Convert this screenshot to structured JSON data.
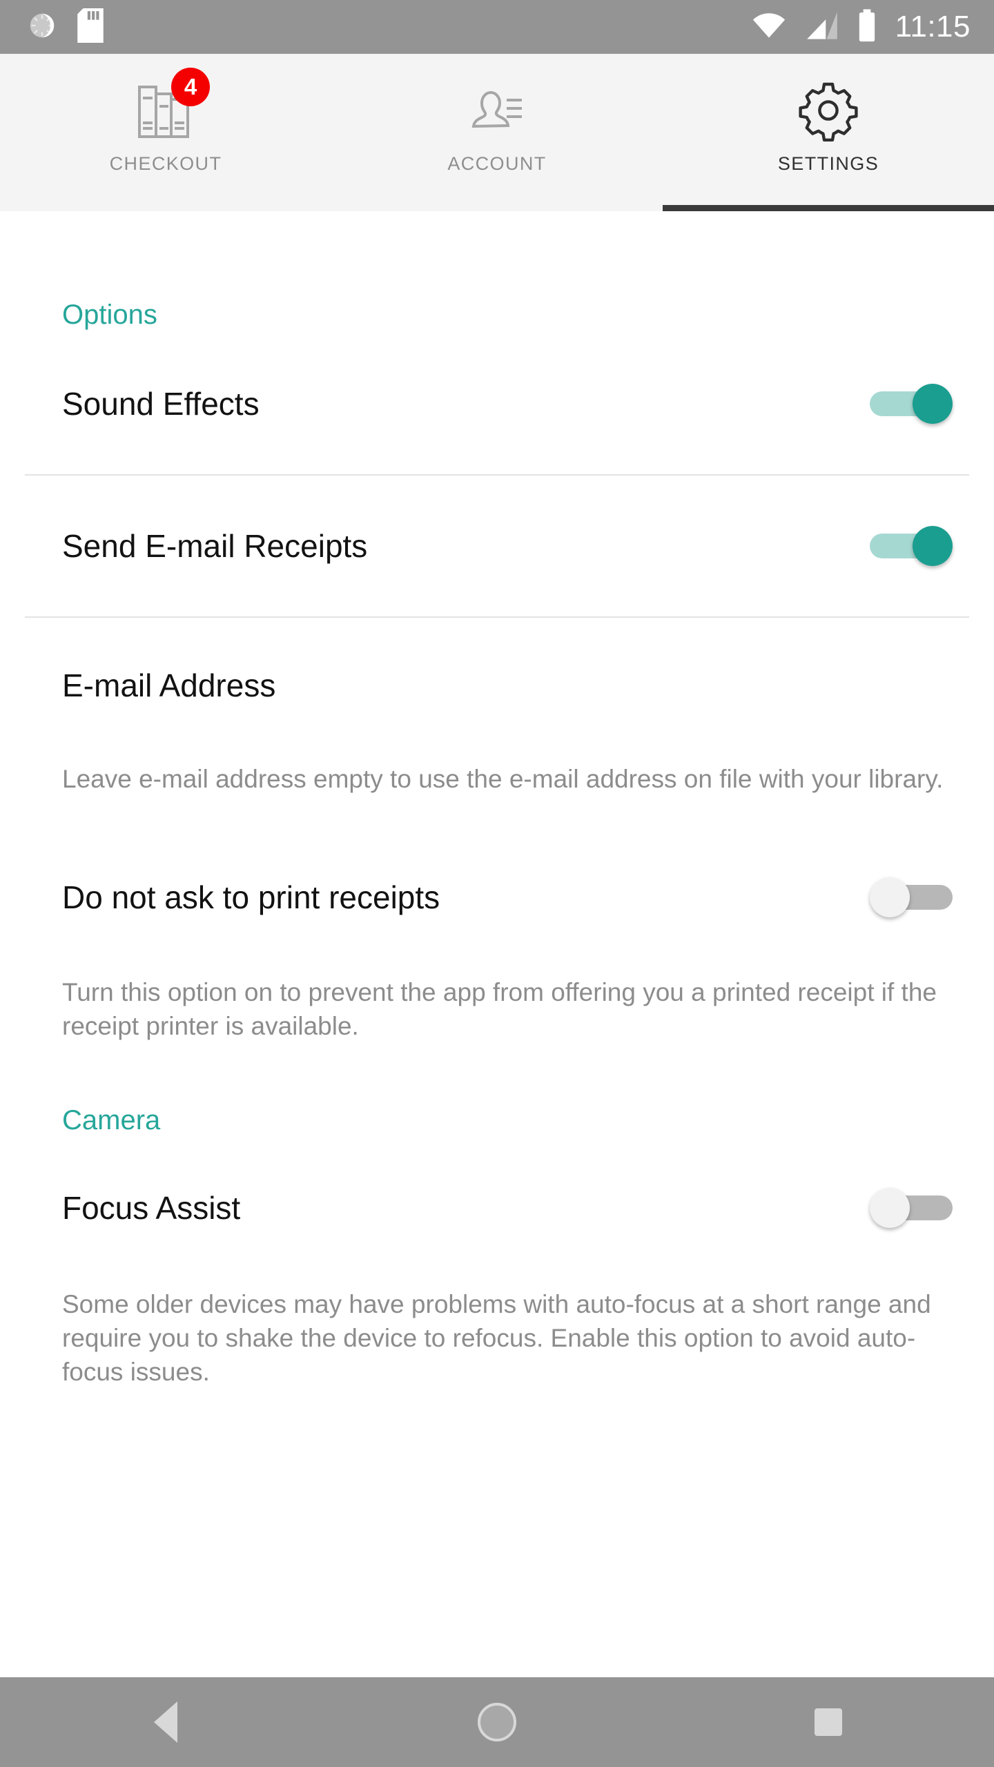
{
  "status_bar": {
    "icons_left": [
      "sync-spinner-icon",
      "sd-card-icon"
    ],
    "icons_right": [
      "wifi-icon",
      "cellular-signal-icon",
      "battery-icon"
    ],
    "time": "11:15"
  },
  "tabs": [
    {
      "label": "CHECKOUT",
      "icon": "books-icon",
      "badge": "4",
      "active": false
    },
    {
      "label": "ACCOUNT",
      "icon": "person-details-icon",
      "badge": null,
      "active": false
    },
    {
      "label": "SETTINGS",
      "icon": "gear-icon",
      "badge": null,
      "active": true
    }
  ],
  "sections": {
    "options": {
      "header": "Options",
      "sound_effects": {
        "label": "Sound Effects",
        "state": "on"
      },
      "send_email_receipts": {
        "label": "Send E-mail Receipts",
        "state": "on"
      },
      "email_address": {
        "label": "E-mail Address",
        "value": ""
      },
      "email_helper": "Leave e-mail address empty to use the e-mail address on file with your library.",
      "do_not_ask_print": {
        "label": "Do not ask to print receipts",
        "state": "off"
      },
      "print_helper": "Turn this option on to prevent the app from offering you a printed receipt if the receipt printer is available."
    },
    "camera": {
      "header": "Camera",
      "focus_assist": {
        "label": "Focus Assist",
        "state": "off"
      },
      "focus_helper": "Some older devices may have problems with auto-focus at a short range and require you to shake the device to refocus. Enable this option to avoid auto-focus issues."
    }
  },
  "nav_bar": {
    "back": "back-triangle-icon",
    "home": "home-circle-icon",
    "recents": "recents-square-icon"
  },
  "colors": {
    "accent_teal": "#26A69A",
    "toggle_on_thumb": "#1a9e90",
    "toggle_on_track": "#a6d8d2",
    "toggle_off_track": "#b7b7b7",
    "badge_red": "#f40000",
    "status_bar_gray": "#949494",
    "tab_bar_gray": "#f4f4f4",
    "active_indicator": "#3a3a3a"
  }
}
